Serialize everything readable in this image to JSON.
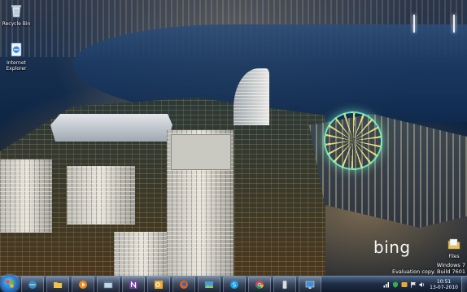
{
  "desktop": {
    "icons": [
      {
        "label": "Recycle Bin",
        "icon": "recycle-bin-icon"
      },
      {
        "label": "Internet Explorer",
        "icon": "internet-explorer-icon"
      },
      {
        "label": "Files",
        "icon": "folder-icon"
      }
    ],
    "wallpaper_brand": "bing",
    "watermark": {
      "line1": "Windows 7",
      "line2": "Evaluation copy. Build 7601"
    }
  },
  "taskbar": {
    "start_icon": "windows-orb-icon",
    "pinned": [
      {
        "name": "internet-explorer",
        "icon": "internet-explorer-icon"
      },
      {
        "name": "windows-explorer",
        "icon": "folder-icon"
      },
      {
        "name": "media-player",
        "icon": "media-player-icon"
      },
      {
        "name": "app-generic",
        "icon": "window-icon"
      },
      {
        "name": "onenote",
        "icon": "onenote-icon"
      },
      {
        "name": "outlook",
        "icon": "outlook-icon"
      },
      {
        "name": "firefox",
        "icon": "firefox-icon"
      },
      {
        "name": "photo-viewer",
        "icon": "photo-icon"
      },
      {
        "name": "skype",
        "icon": "skype-icon"
      },
      {
        "name": "chrome",
        "icon": "chrome-icon"
      },
      {
        "name": "device",
        "icon": "phone-icon"
      },
      {
        "name": "screen-capture",
        "icon": "screen-icon"
      }
    ],
    "tray_icons": [
      "network-icon",
      "shield-icon",
      "onedrive-icon",
      "flag-icon",
      "volume-icon"
    ],
    "clock": {
      "time": "10:51",
      "date": "13-07-2010"
    }
  },
  "colors": {
    "taskbar": "#1a2a44",
    "accent": "#2c7dd6",
    "text": "#ffffff"
  }
}
